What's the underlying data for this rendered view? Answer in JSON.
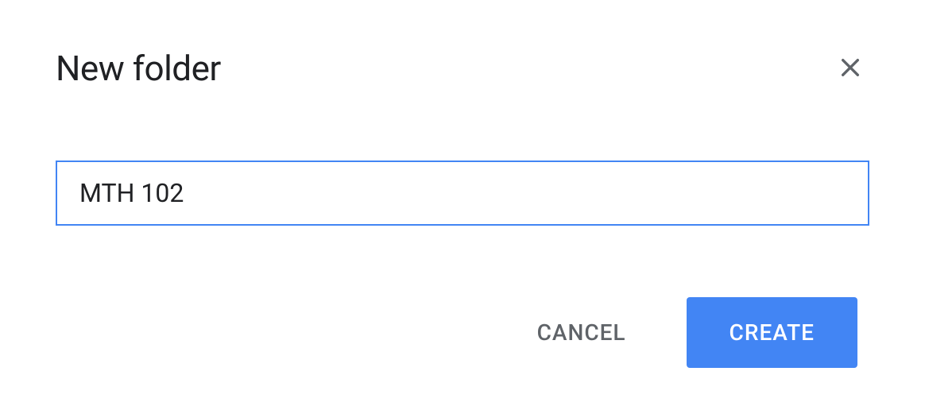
{
  "dialog": {
    "title": "New folder",
    "input_value": "MTH 102",
    "cancel_label": "CANCEL",
    "create_label": "CREATE"
  }
}
